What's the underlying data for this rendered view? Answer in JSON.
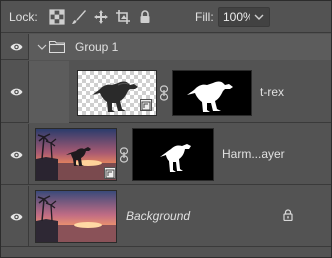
{
  "toolbar": {
    "lock_label": "Lock:",
    "lock_icons": [
      "lock-transparent-pixels-icon",
      "lock-image-pixels-icon",
      "lock-position-icon",
      "lock-artboard-icon",
      "lock-all-icon"
    ],
    "fill_label": "Fill:",
    "fill_value": "100%"
  },
  "layers": {
    "group": {
      "name": "Group 1",
      "expanded": true,
      "visible": true
    },
    "trex": {
      "name": "t-rex",
      "visible": true,
      "type": "smart-object",
      "has_mask": true
    },
    "harmonization": {
      "name": "Harm...ayer",
      "visible": true,
      "type": "smart-object",
      "has_mask": true
    },
    "background": {
      "name": "Background",
      "visible": true,
      "locked": true
    }
  },
  "colors": {
    "panel_bg": "#535353",
    "group_bg": "#5c5c5c",
    "divider": "#3a3a3a",
    "text": "#e0e0e0"
  }
}
